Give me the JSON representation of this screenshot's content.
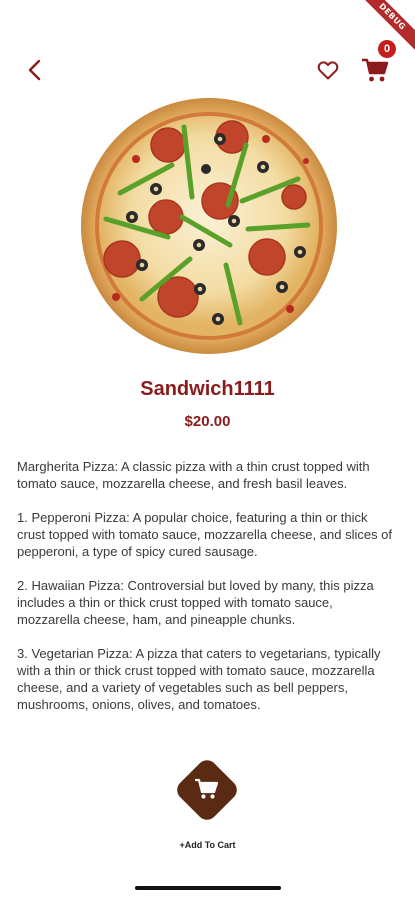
{
  "debug_banner": "DEBUG",
  "header": {
    "cart_count": "0"
  },
  "product": {
    "name": "Sandwich1111",
    "price": "$20.00",
    "description": "Margherita Pizza: A classic pizza with a thin crust topped with tomato sauce, mozzarella cheese, and fresh basil leaves.\n\n1. Pepperoni Pizza: A popular choice, featuring a thin or thick crust topped with tomato sauce, mozzarella cheese, and slices of pepperoni, a type of spicy cured sausage.\n\n2. Hawaiian Pizza: Controversial but loved by many, this pizza includes a thin or thick crust topped with tomato sauce, mozzarella cheese, ham, and pineapple chunks.\n\n3. Vegetarian Pizza: A pizza that caters to vegetarians, typically with a thin or thick crust topped with tomato sauce, mozzarella cheese, and a variety of vegetables such as bell peppers, mushrooms, onions, olives, and tomatoes."
  },
  "actions": {
    "add_to_cart_label": "+Add To Cart"
  },
  "icons": {
    "back": "back-arrow-icon",
    "favorite": "heart-outline-icon",
    "cart": "shopping-cart-icon",
    "add_cart": "cart-icon"
  },
  "colors": {
    "accent": "#8b1a1a",
    "badge": "#c41e1e",
    "button": "#5a2a12"
  }
}
